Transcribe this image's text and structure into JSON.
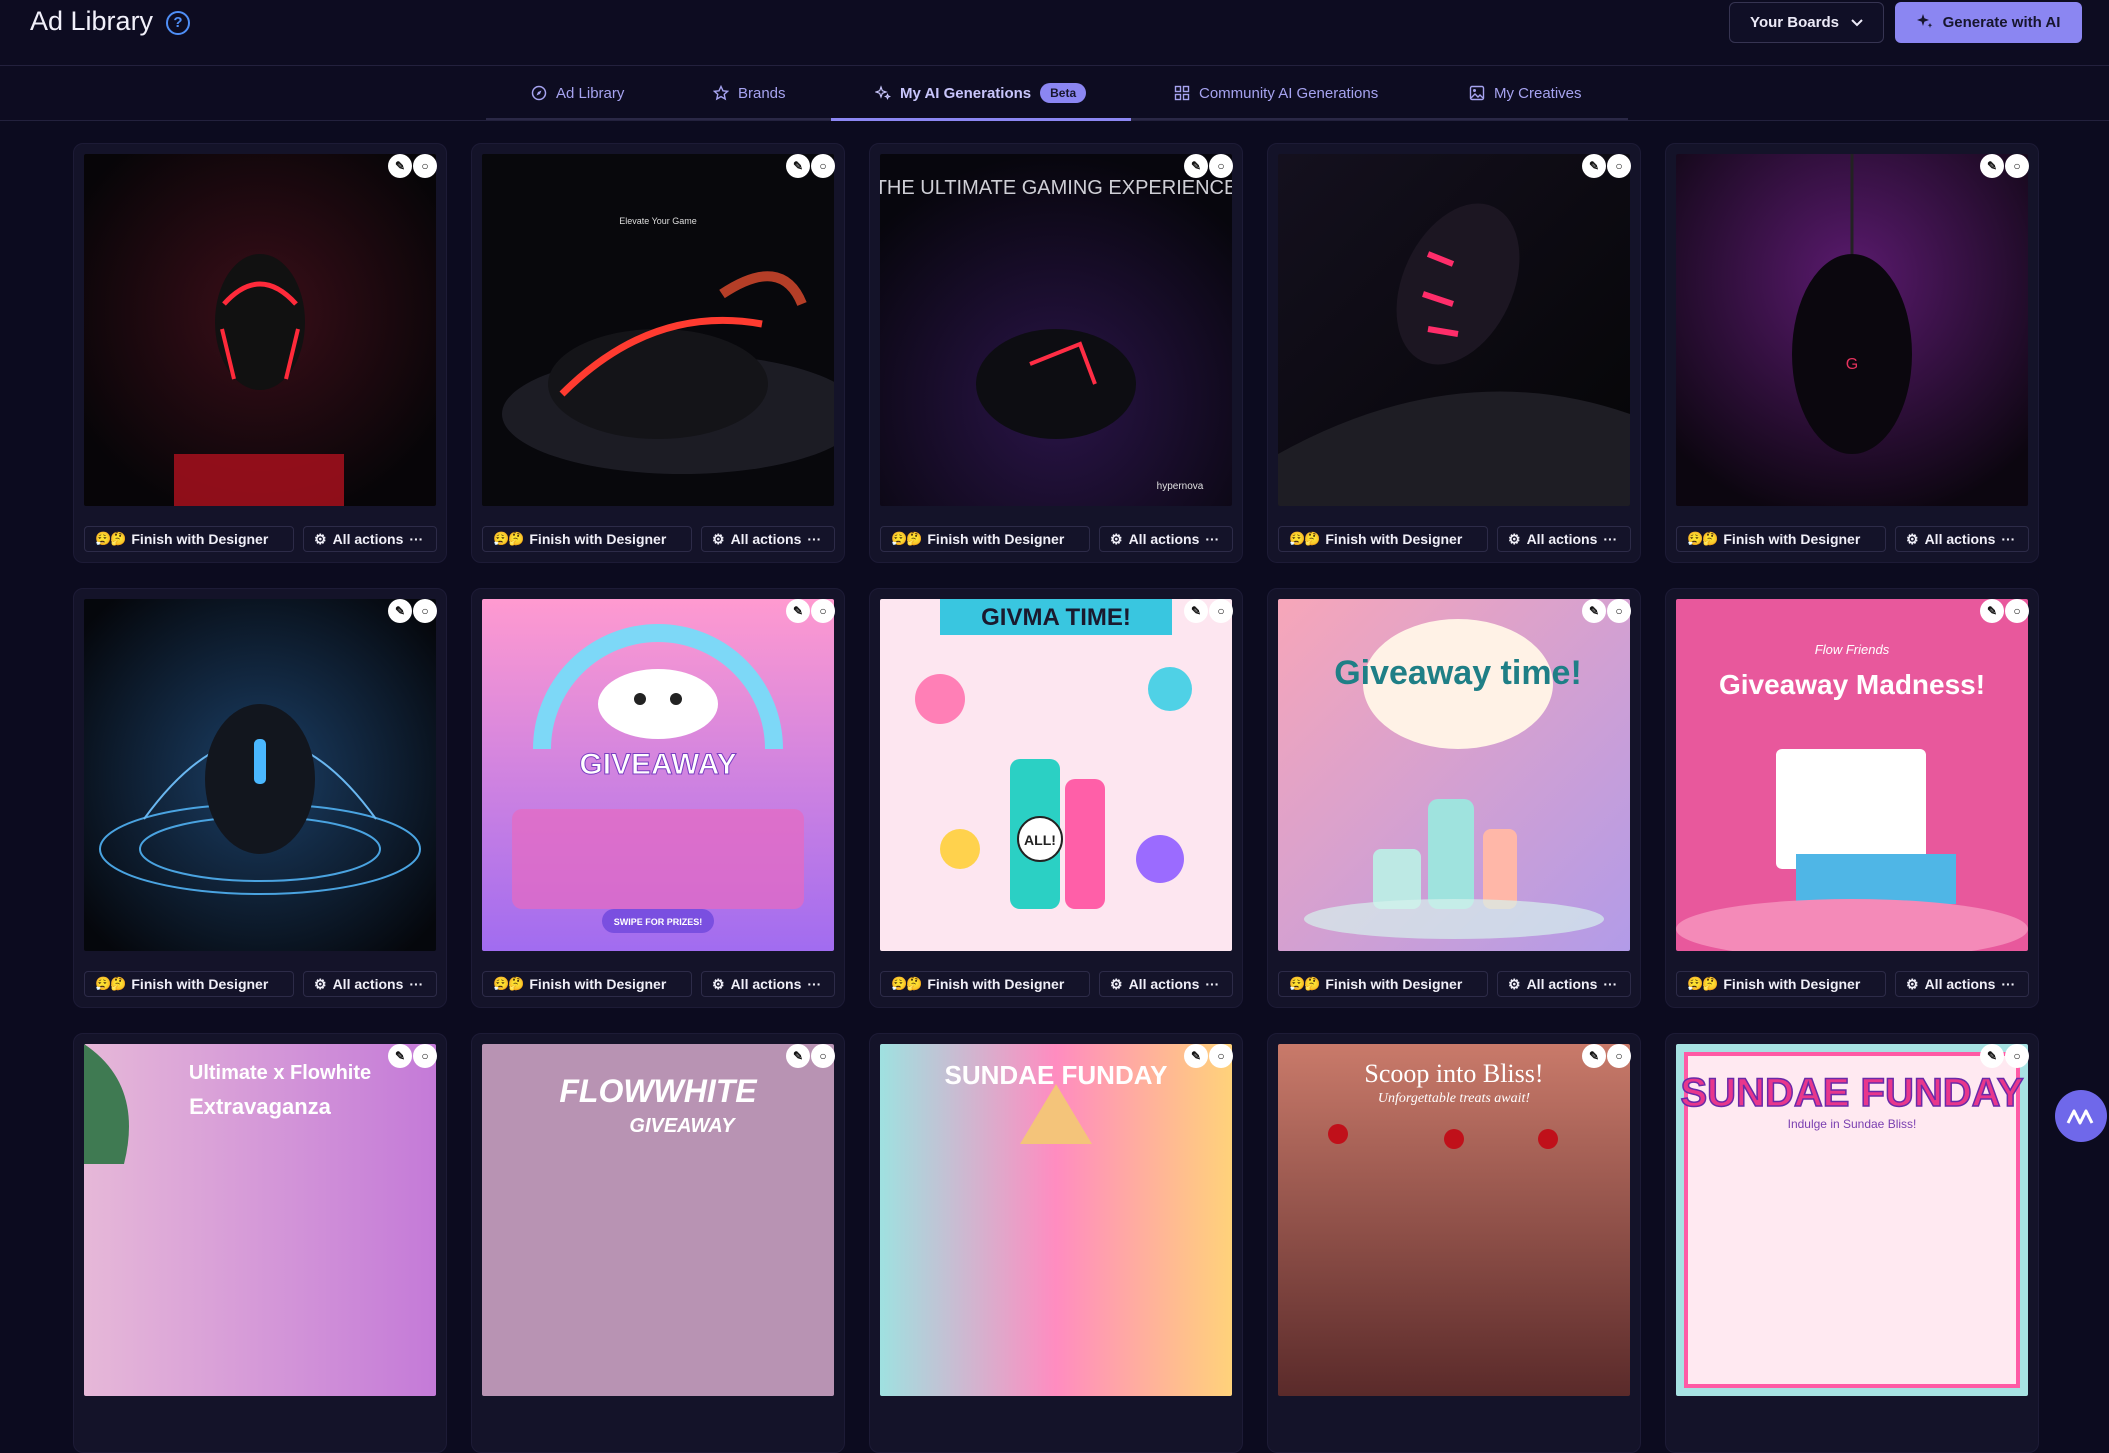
{
  "header": {
    "title": "Ad Library",
    "help_icon": "question-circle-icon",
    "boards_label": "Your Boards",
    "generate_label": "Generate with AI"
  },
  "tabs": [
    {
      "label": "Ad Library",
      "icon": "compass-icon"
    },
    {
      "label": "Brands",
      "icon": "star-icon"
    },
    {
      "label": "My AI Generations",
      "badge": "Beta",
      "icon": "sparkle-icon"
    },
    {
      "label": "Community AI Generations",
      "icon": "grid-icon"
    },
    {
      "label": "My Creatives",
      "icon": "image-icon"
    }
  ],
  "card_labels": {
    "finish": "Finish with Designer",
    "all_actions": "All actions"
  },
  "cards": [
    {
      "text": ""
    },
    {
      "text": "Elevate Your Game"
    },
    {
      "text": "THE ULTIMATE GAMING EXPERIENCE",
      "sub": "hypernova"
    },
    {
      "text": ""
    },
    {
      "text": ""
    },
    {
      "text": ""
    },
    {
      "text": "GIVEAWAY",
      "sub": "SWIPE FOR PRIZES!"
    },
    {
      "text": "GIVMA TIME!",
      "sub": "ALL!"
    },
    {
      "text": "Giveaway time!"
    },
    {
      "text": "Giveaway Madness!",
      "sub": "Flow Friends"
    },
    {
      "text": "Ultimate x Flowhite",
      "sub": "Extravaganza"
    },
    {
      "text": "FLOWWHITE",
      "sub": "GIVEAWAY"
    },
    {
      "text": "SUNDAE FUNDAY"
    },
    {
      "text": "Scoop into Bliss!",
      "sub": "Unforgettable treats await!"
    },
    {
      "text": "SUNDAE FUNDAY",
      "sub": "Indulge in Sundae Bliss!"
    }
  ],
  "colors": {
    "accent": "#8b86f2",
    "background": "#0c0b1f"
  }
}
